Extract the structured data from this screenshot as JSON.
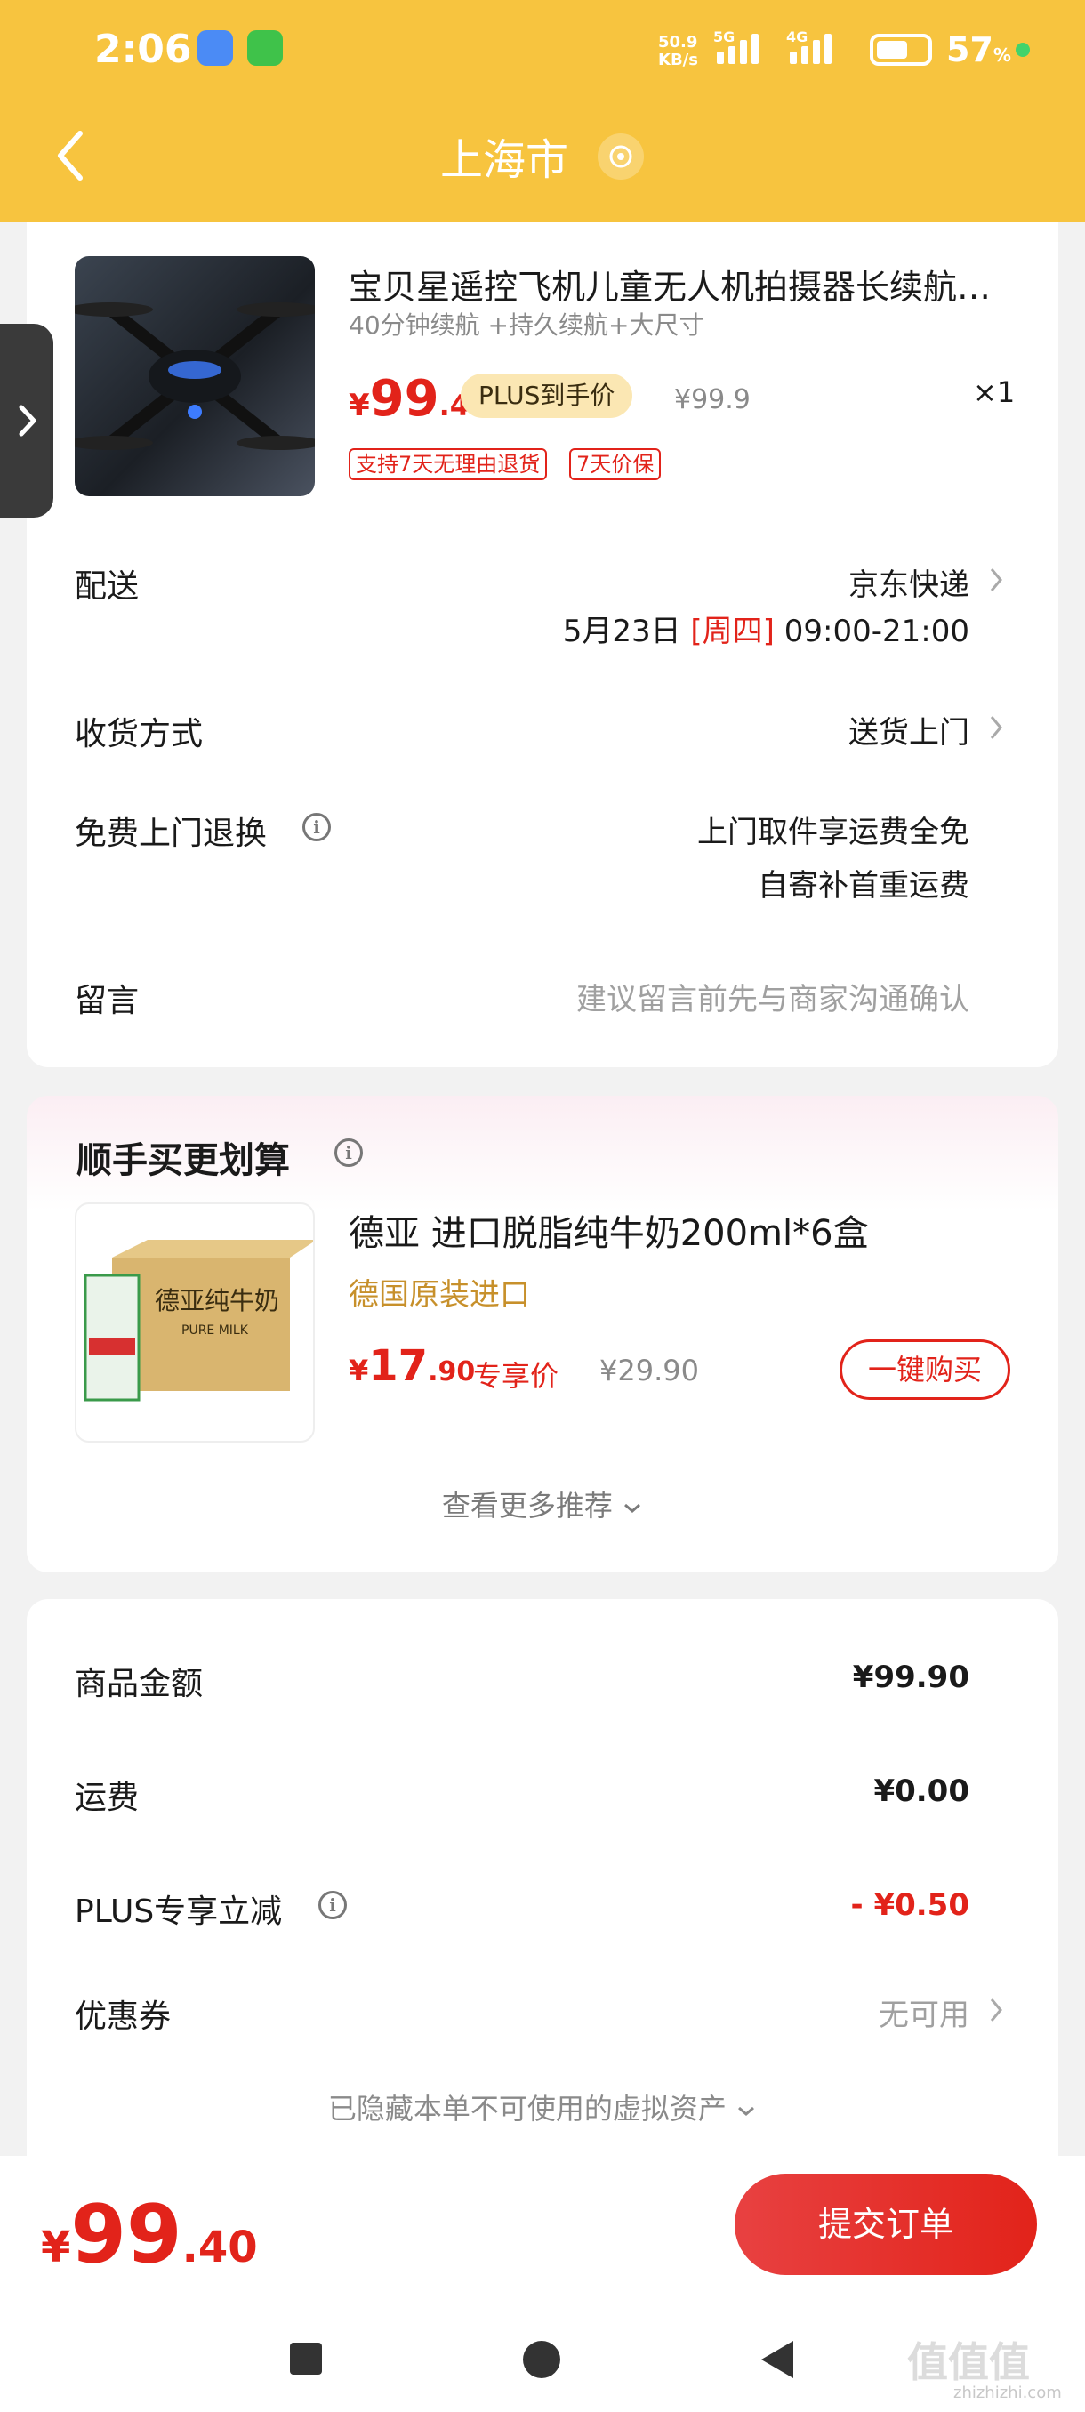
{
  "status_bar": {
    "time": "2:06",
    "net_speed_top": "50.9",
    "net_speed_bottom": "KB/s",
    "net1": "5G",
    "net2": "4G",
    "battery": "57",
    "battery_unit": "%"
  },
  "header": {
    "title": "上海市"
  },
  "product": {
    "name": "宝贝星遥控飞机儿童无人机拍摄器长续航…",
    "subtitle": "40分钟续航 +持久续航+大尺寸",
    "price_symbol": "¥",
    "price_int": "99",
    "price_dec": ".4",
    "plus_badge": "PLUS到手价",
    "orig_price": "¥99.9",
    "quantity": "×1",
    "tags": [
      "支持7天无理由退货",
      "7天价保"
    ]
  },
  "delivery": {
    "label": "配送",
    "carrier": "京东快递",
    "date": "5月23日",
    "weekday": "[周四]",
    "time_window": "09:00-21:00"
  },
  "receive": {
    "label": "收货方式",
    "value": "送货上门"
  },
  "free_return": {
    "label": "免费上门退换",
    "line1": "上门取件享运费全免",
    "line2": "自寄补首重运费"
  },
  "message": {
    "label": "留言",
    "placeholder": "建议留言前先与商家沟通确认"
  },
  "addon": {
    "title": "顺手买更划算",
    "item_name": "德亚 进口脱脂纯牛奶200ml*6盒",
    "item_sub": "德国原装进口",
    "price_symbol": "¥",
    "price_int": "17",
    "price_dec": ".90",
    "price_tag": "专享价",
    "orig_price": "¥29.90",
    "buy_label": "一键购买",
    "box_text": "德亚纯牛奶",
    "box_sub": "PURE MILK",
    "more_label": "查看更多推荐"
  },
  "summary": {
    "goods_label": "商品金额",
    "goods_value": "¥99.90",
    "shipping_label": "运费",
    "shipping_value": "¥0.00",
    "plus_label": "PLUS专享立减",
    "plus_value": "- ¥0.50",
    "coupon_label": "优惠券",
    "coupon_value": "无可用",
    "hidden_label": "已隐藏本单不可使用的虚拟资产"
  },
  "footer": {
    "total_symbol": "¥",
    "total_int": "99",
    "total_dec": ".40",
    "submit_label": "提交订单"
  },
  "watermark": {
    "main": "值值值",
    "sub": "zhizhizhi.com"
  },
  "colors": {
    "header": "#f7c43f",
    "accent_red": "#e2231a",
    "gold": "#c7902b"
  }
}
